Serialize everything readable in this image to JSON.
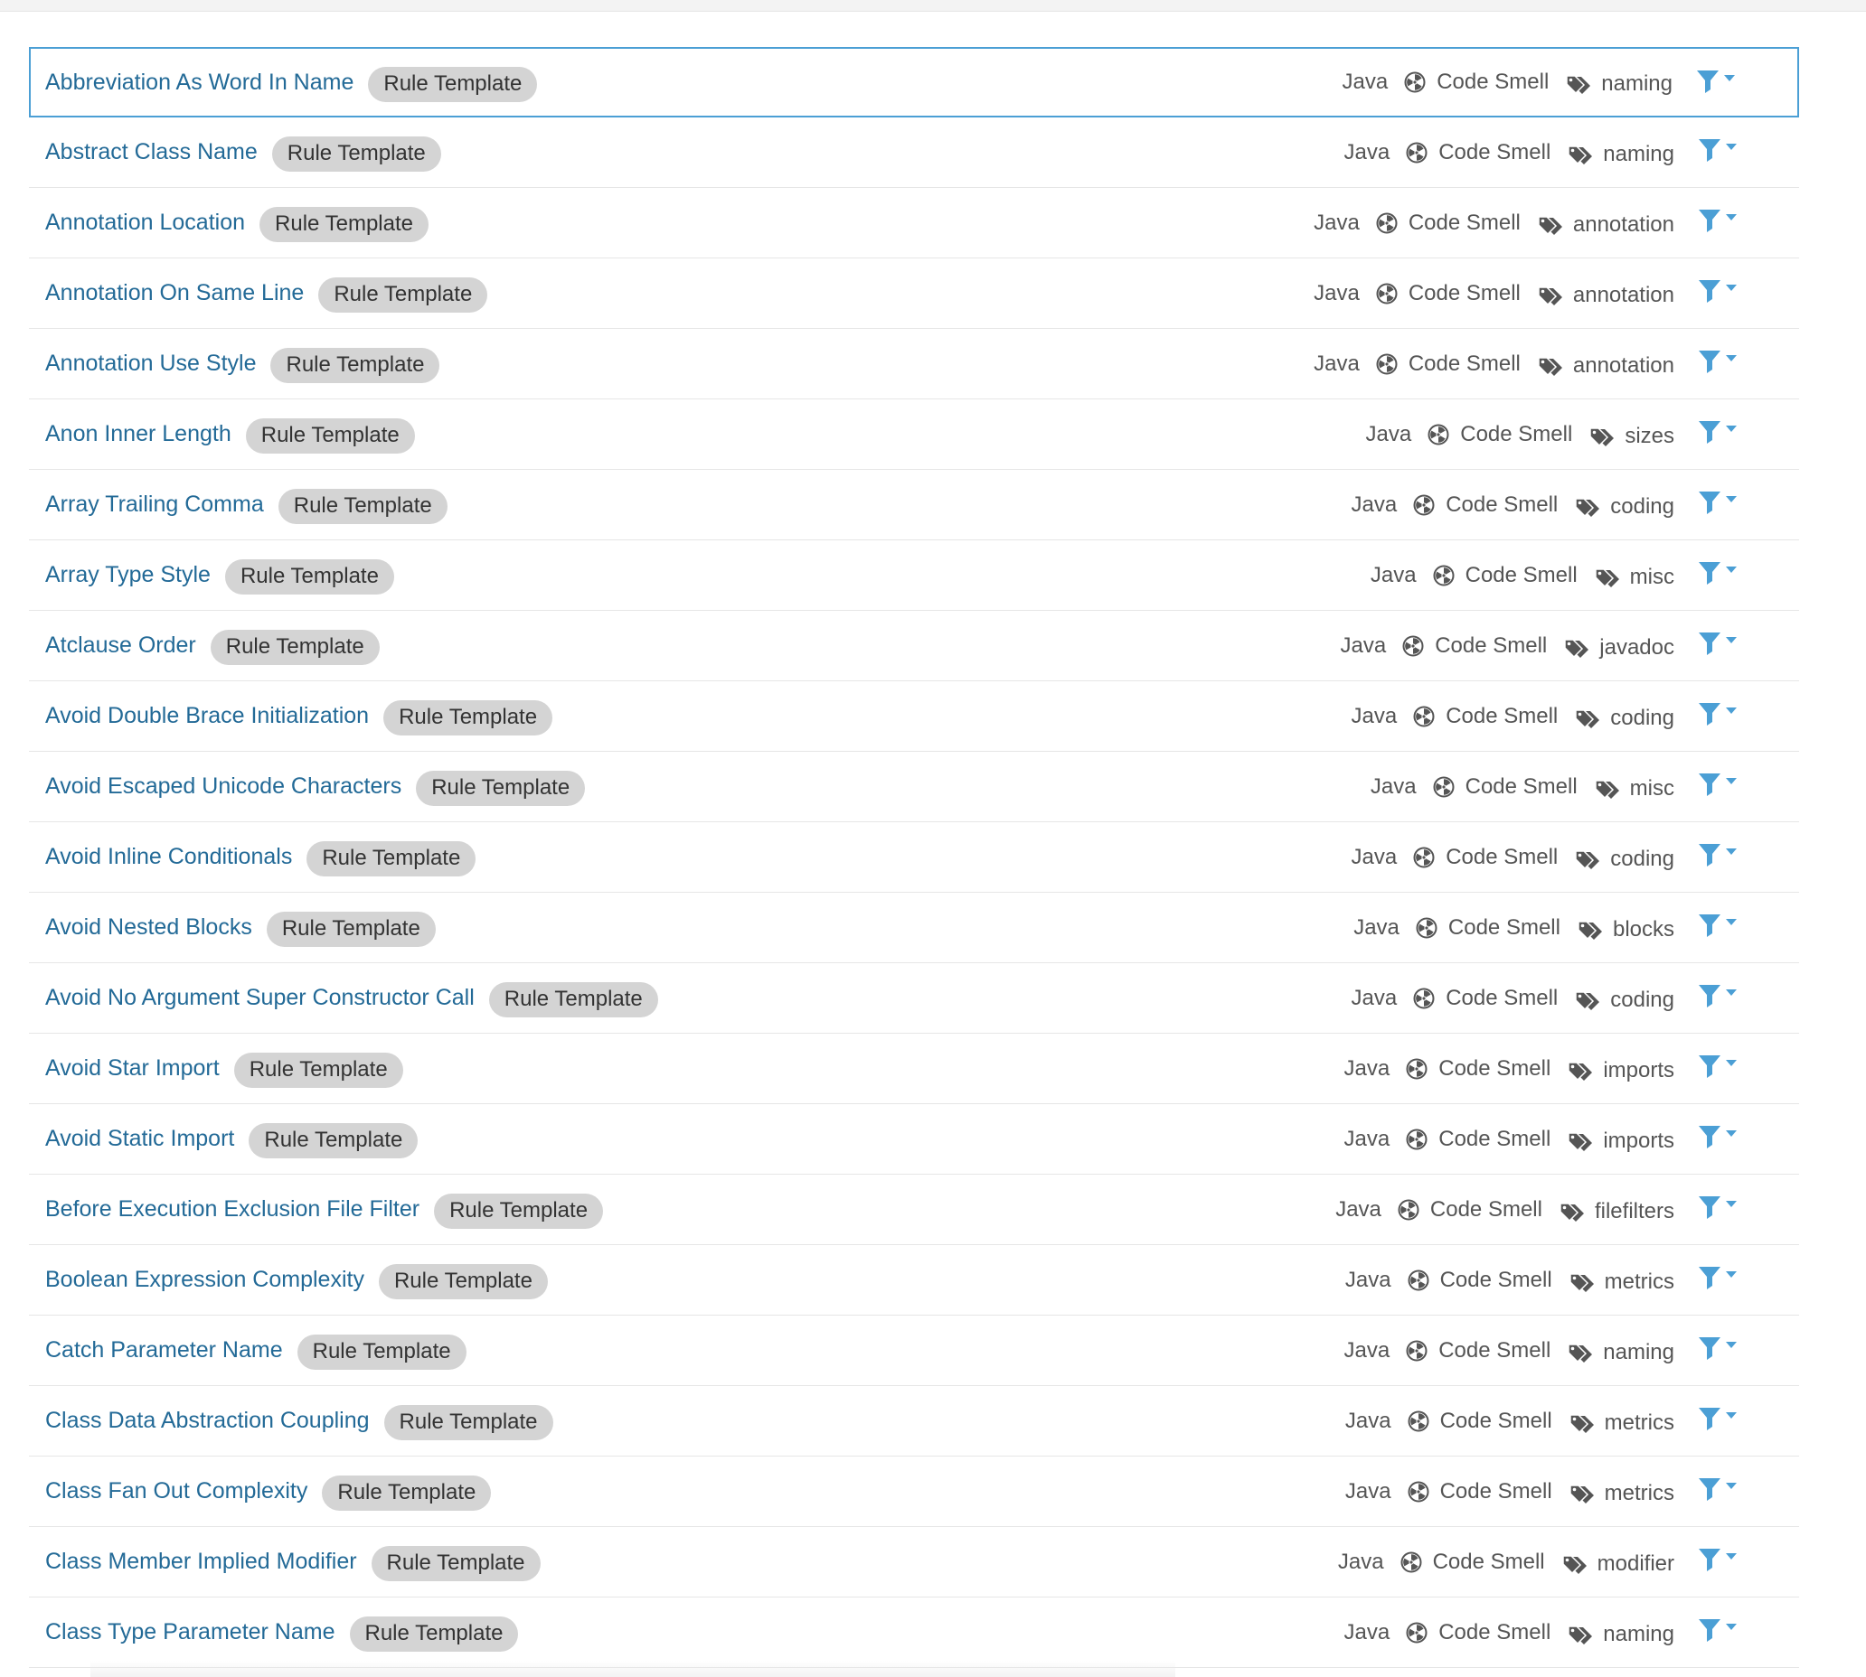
{
  "badge_label": "Rule Template",
  "colors": {
    "link": "#236a97",
    "badge_bg": "#d4d4d4",
    "meta_text": "#555555",
    "selected_border": "#4b9fd5",
    "filter_icon": "#4b9fd5"
  },
  "icons": {
    "type": "code-smell-icon",
    "tag": "tag-icon",
    "filter": "filter-icon",
    "caret": "chevron-down-icon"
  },
  "rules": [
    {
      "name": "Abbreviation As Word In Name",
      "language": "Java",
      "type": "Code Smell",
      "tag": "naming",
      "selected": true
    },
    {
      "name": "Abstract Class Name",
      "language": "Java",
      "type": "Code Smell",
      "tag": "naming"
    },
    {
      "name": "Annotation Location",
      "language": "Java",
      "type": "Code Smell",
      "tag": "annotation"
    },
    {
      "name": "Annotation On Same Line",
      "language": "Java",
      "type": "Code Smell",
      "tag": "annotation"
    },
    {
      "name": "Annotation Use Style",
      "language": "Java",
      "type": "Code Smell",
      "tag": "annotation"
    },
    {
      "name": "Anon Inner Length",
      "language": "Java",
      "type": "Code Smell",
      "tag": "sizes"
    },
    {
      "name": "Array Trailing Comma",
      "language": "Java",
      "type": "Code Smell",
      "tag": "coding"
    },
    {
      "name": "Array Type Style",
      "language": "Java",
      "type": "Code Smell",
      "tag": "misc"
    },
    {
      "name": "Atclause Order",
      "language": "Java",
      "type": "Code Smell",
      "tag": "javadoc"
    },
    {
      "name": "Avoid Double Brace Initialization",
      "language": "Java",
      "type": "Code Smell",
      "tag": "coding"
    },
    {
      "name": "Avoid Escaped Unicode Characters",
      "language": "Java",
      "type": "Code Smell",
      "tag": "misc"
    },
    {
      "name": "Avoid Inline Conditionals",
      "language": "Java",
      "type": "Code Smell",
      "tag": "coding"
    },
    {
      "name": "Avoid Nested Blocks",
      "language": "Java",
      "type": "Code Smell",
      "tag": "blocks"
    },
    {
      "name": "Avoid No Argument Super Constructor Call",
      "language": "Java",
      "type": "Code Smell",
      "tag": "coding"
    },
    {
      "name": "Avoid Star Import",
      "language": "Java",
      "type": "Code Smell",
      "tag": "imports"
    },
    {
      "name": "Avoid Static Import",
      "language": "Java",
      "type": "Code Smell",
      "tag": "imports"
    },
    {
      "name": "Before Execution Exclusion File Filter",
      "language": "Java",
      "type": "Code Smell",
      "tag": "filefilters"
    },
    {
      "name": "Boolean Expression Complexity",
      "language": "Java",
      "type": "Code Smell",
      "tag": "metrics"
    },
    {
      "name": "Catch Parameter Name",
      "language": "Java",
      "type": "Code Smell",
      "tag": "naming"
    },
    {
      "name": "Class Data Abstraction Coupling",
      "language": "Java",
      "type": "Code Smell",
      "tag": "metrics"
    },
    {
      "name": "Class Fan Out Complexity",
      "language": "Java",
      "type": "Code Smell",
      "tag": "metrics"
    },
    {
      "name": "Class Member Implied Modifier",
      "language": "Java",
      "type": "Code Smell",
      "tag": "modifier"
    },
    {
      "name": "Class Type Parameter Name",
      "language": "Java",
      "type": "Code Smell",
      "tag": "naming"
    }
  ]
}
